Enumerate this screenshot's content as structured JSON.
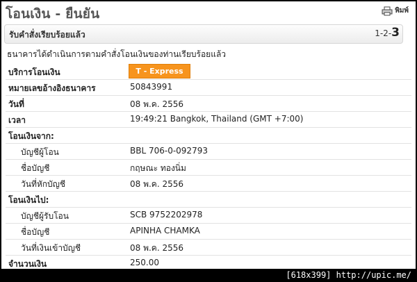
{
  "header": {
    "title": "โอนเงิน - ยืนยัน",
    "print_label": "พิมพ์"
  },
  "stepbar": {
    "label": "รับคำสั่งเรียบร้อยแล้ว",
    "steps_prefix": "1-2-",
    "current_step": "3"
  },
  "confirm_message": "ธนาคารได้ดำเนินการตามคำสั่งโอนเงินของท่านเรียบร้อยแล้ว",
  "details": {
    "service_label": "บริการโอนเงิน",
    "service_value": "T - Express",
    "ref_label": "หมายเลขอ้างอิงธนาคาร",
    "ref_value": "50843991",
    "date_label": "วันที่",
    "date_value": "08 พ.ค. 2556",
    "time_label": "เวลา",
    "time_value": "19:49:21 Bangkok, Thailand (GMT +7:00)"
  },
  "from": {
    "section_label": "โอนเงินจาก:",
    "account_label": "บัญชีผู้โอน",
    "account_value": "BBL 706-0-092793",
    "name_label": "ชื่อบัญชี",
    "name_value": "กฤษณะ ทองนิ่ม",
    "debit_date_label": "วันที่หักบัญชี",
    "debit_date_value": "08 พ.ค. 2556"
  },
  "to": {
    "section_label": "โอนเงินไป:",
    "account_label": "บัญชีผู้รับโอน",
    "account_value": "SCB 9752202978",
    "name_label": "ชื่อบัญชี",
    "name_value": "APINHA CHAMKA",
    "credit_date_label": "วันที่เงินเข้าบัญชี",
    "credit_date_value": "08 พ.ค. 2556"
  },
  "amount": {
    "label": "จำนวนเงิน",
    "value": "250.00"
  },
  "footer_text": "[618x399] http://upic.me/",
  "colors": {
    "badge": "#f7941d",
    "title": "#555555"
  }
}
